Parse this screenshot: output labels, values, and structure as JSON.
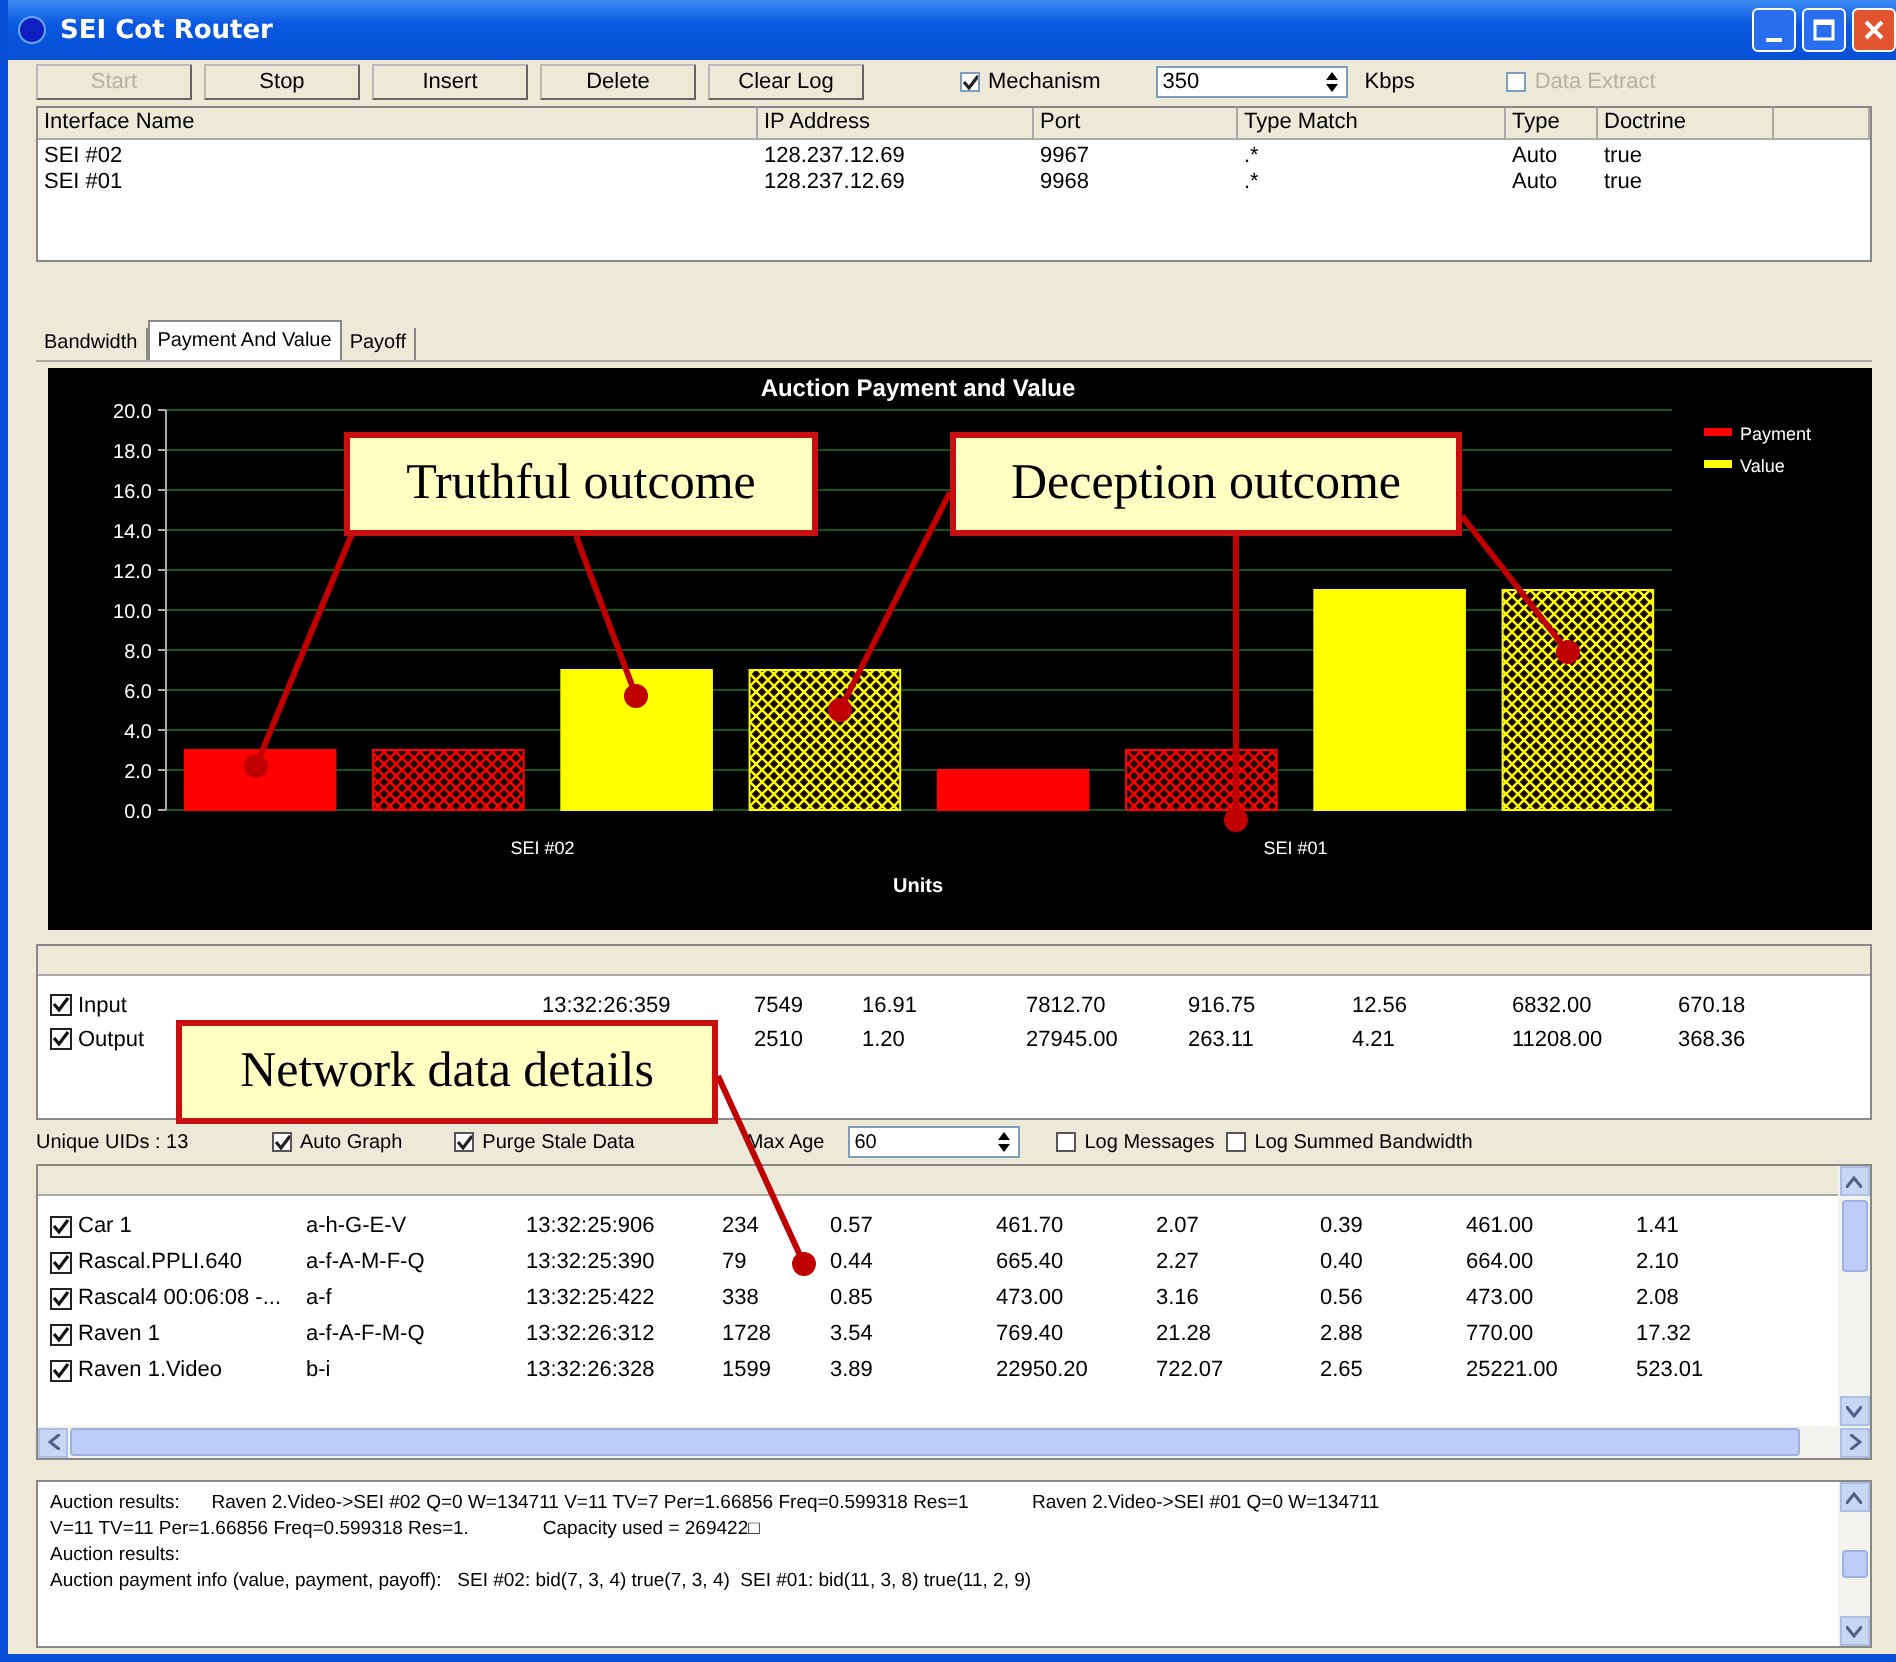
{
  "window": {
    "title": "SEI Cot Router"
  },
  "toolbar": {
    "buttons": [
      {
        "label": "Start",
        "disabled": true
      },
      {
        "label": "Stop",
        "disabled": false
      },
      {
        "label": "Insert",
        "disabled": false
      },
      {
        "label": "Delete",
        "disabled": false
      },
      {
        "label": "Clear Log",
        "disabled": false
      }
    ],
    "mechanism": {
      "label": "Mechanism",
      "checked": true,
      "disabled": false
    },
    "rate": {
      "value": "350",
      "unit": "Kbps"
    },
    "data_extract": {
      "label": "Data Extract",
      "checked": false,
      "disabled": true
    }
  },
  "interfaces": {
    "columns": [
      "Interface Name",
      "IP Address",
      "Port",
      "Type Match",
      "Type",
      "Doctrine"
    ],
    "rows": [
      [
        "SEI #02",
        "128.237.12.69",
        "9967",
        ".*",
        "Auto",
        "true"
      ],
      [
        "SEI #01",
        "128.237.12.69",
        "9968",
        ".*",
        "Auto",
        "true"
      ]
    ]
  },
  "tabs": [
    {
      "label": "Bandwidth",
      "selected": false
    },
    {
      "label": "Payment And Value",
      "selected": true
    },
    {
      "label": "Payoff",
      "selected": false
    }
  ],
  "chart": {
    "chart_data": {
      "type": "bar",
      "title": "Auction  Payment and Value",
      "xlabel": "Units",
      "categories": [
        "SEI #02",
        "SEI #01"
      ],
      "ylim": [
        0,
        20
      ],
      "grid": true,
      "legend": true,
      "yticks": [
        {
          "value": 0,
          "label": "0.0"
        },
        {
          "value": 2,
          "label": "2.0"
        },
        {
          "value": 4,
          "label": "4.0"
        },
        {
          "value": 6,
          "label": "6.0"
        },
        {
          "value": 8,
          "label": "8.0"
        },
        {
          "value": 10,
          "label": "10.0"
        },
        {
          "value": 12,
          "label": "12.0"
        },
        {
          "value": 14,
          "label": "14.0"
        },
        {
          "value": 16,
          "label": "16.0"
        },
        {
          "value": 18,
          "label": "18.0"
        },
        {
          "value": 20,
          "label": "20.0"
        }
      ],
      "series": [
        {
          "name": "Payment",
          "color": "#ff0000",
          "values": [
            3,
            2
          ]
        },
        {
          "color": "#ff0000",
          "values": [
            3,
            3
          ]
        },
        {
          "name": "Value",
          "color": "#ffff00",
          "values": [
            7,
            11
          ]
        },
        {
          "color": "#ffff00",
          "values": [
            7,
            11
          ]
        }
      ]
    }
  },
  "traffic": {
    "rows": [
      {
        "name": "Input",
        "checked": true,
        "time": "13:32:26:359",
        "cells": [
          "7549",
          "16.91",
          "7812.70",
          "916.75",
          "12.56",
          "6832.00",
          "670.18"
        ]
      },
      {
        "name": "Output",
        "checked": true,
        "cells": [
          "2510",
          "1.20",
          "27945.00",
          "263.11",
          "4.21",
          "11208.00",
          "368.36"
        ]
      }
    ]
  },
  "options": {
    "unique_uids": "Unique UIDs :  13",
    "checks": [
      {
        "label": "Auto Graph",
        "checked": true
      },
      {
        "label": "Purge Stale Data",
        "checked": true
      }
    ],
    "max_age": {
      "label": "Max Age",
      "value": "60"
    },
    "log_checks": [
      {
        "label": "Log Messages",
        "checked": false
      },
      {
        "label": "Log Summed Bandwidth",
        "checked": false
      }
    ]
  },
  "flows": {
    "rows": [
      {
        "name": "Car 1",
        "checked": true,
        "cells": [
          "a-h-G-E-V",
          "13:32:25:906",
          "234",
          "0.57",
          "461.70",
          "2.07",
          "0.39",
          "461.00",
          "1.41"
        ]
      },
      {
        "name": "Rascal.PPLI.640",
        "checked": true,
        "cells": [
          "a-f-A-M-F-Q",
          "13:32:25:390",
          "79",
          "0.44",
          "665.40",
          "2.27",
          "0.40",
          "664.00",
          "2.10"
        ]
      },
      {
        "name": "Rascal4 00:06:08 -...",
        "checked": true,
        "cells": [
          "a-f",
          "13:32:25:422",
          "338",
          "0.85",
          "473.00",
          "3.16",
          "0.56",
          "473.00",
          "2.08"
        ]
      },
      {
        "name": "Raven 1",
        "checked": true,
        "cells": [
          "a-f-A-F-M-Q",
          "13:32:26:312",
          "1728",
          "3.54",
          "769.40",
          "21.28",
          "2.88",
          "770.00",
          "17.32"
        ]
      },
      {
        "name": "Raven 1.Video",
        "checked": true,
        "cells": [
          "b-i",
          "13:32:26:328",
          "1599",
          "3.89",
          "22950.20",
          "722.07",
          "2.65",
          "25221.00",
          "523.01"
        ]
      }
    ]
  },
  "log": {
    "lines": [
      "Auction results:      Raven 2.Video->SEI #02 Q=0 W=134711 V=11 TV=7 Per=1.66856 Freq=0.599318 Res=1            Raven 2.Video->SEI #01 Q=0 W=134711",
      "V=11 TV=11 Per=1.66856 Freq=0.599318 Res=1.              Capacity used = 269422□",
      "Auction results:",
      "Auction payment info (value, payment, payoff):   SEI #02: bid(7, 3, 4) true(7, 3, 4)  SEI #01: bid(11, 3, 8) true(11, 2, 9)"
    ]
  },
  "callouts": [
    {
      "text": "Truthful outcome"
    },
    {
      "text": "Deception outcome"
    },
    {
      "text": "Network data details"
    }
  ]
}
